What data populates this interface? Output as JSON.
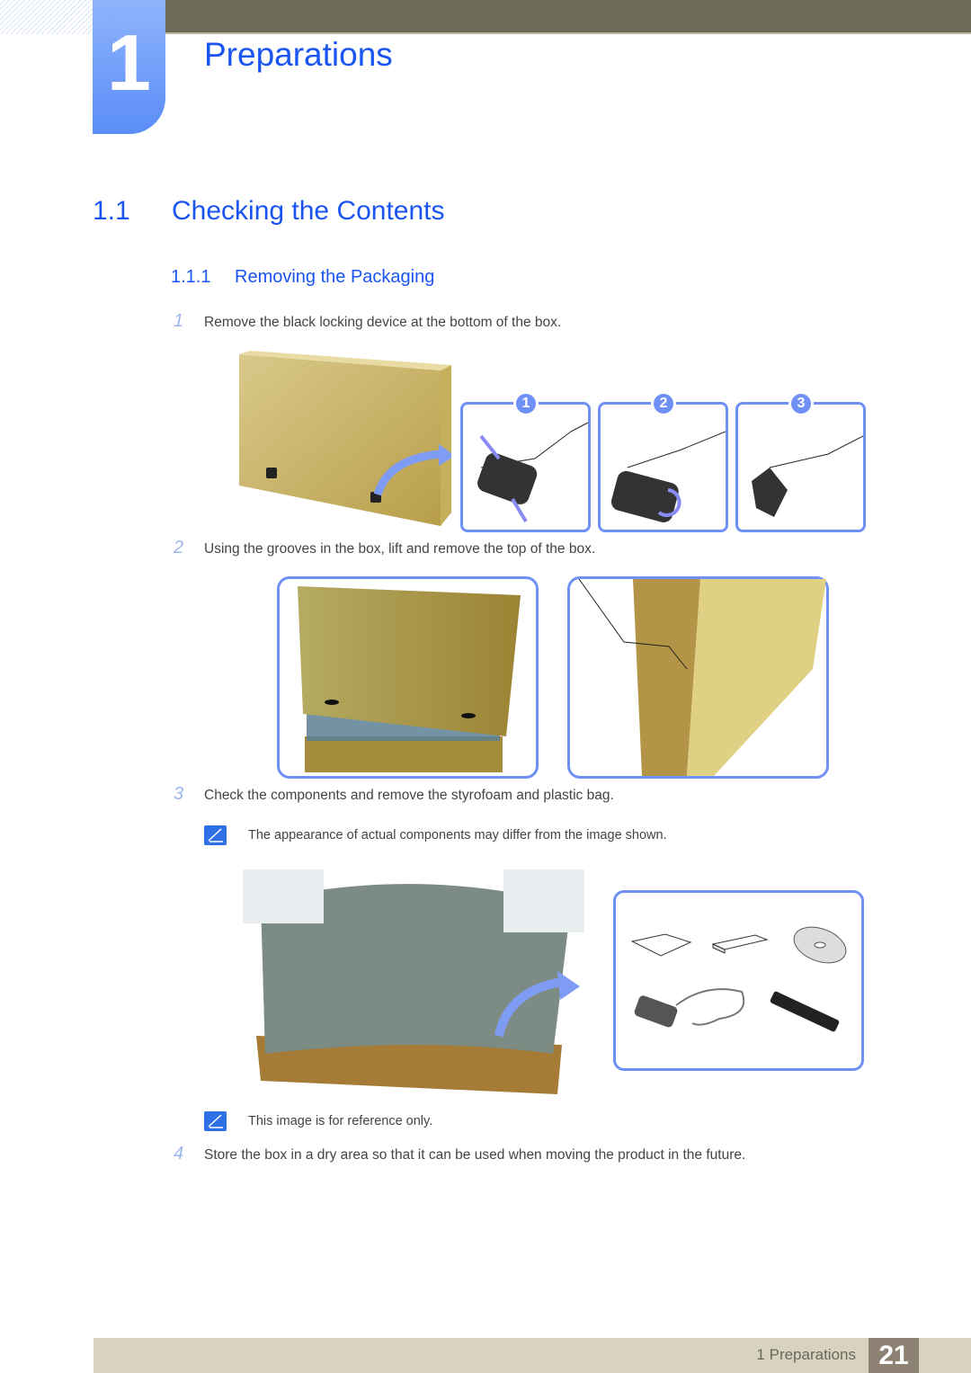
{
  "chapter": {
    "number": "1",
    "title": "Preparations"
  },
  "section": {
    "number": "1.1",
    "title": "Checking the Contents"
  },
  "subsection": {
    "number": "1.1.1",
    "title": "Removing the Packaging"
  },
  "steps": [
    {
      "number": "1",
      "text": "Remove the black locking device at the bottom of the box."
    },
    {
      "number": "2",
      "text": "Using the grooves in the box, lift and remove the top of the box."
    },
    {
      "number": "3",
      "text": "Check the components and remove the styrofoam and plastic bag."
    },
    {
      "number": "4",
      "text": "Store the box in a dry area so that it can be used when moving the product in the future."
    }
  ],
  "notes": [
    {
      "icon": "note-pencil-icon",
      "text": "The appearance of actual components may differ from the image shown."
    },
    {
      "icon": "note-pencil-icon",
      "text": "This image is for reference only."
    }
  ],
  "figures": {
    "step1_badges": [
      "1",
      "2",
      "3"
    ],
    "components": [
      "manual-icon",
      "warranty-card-icon",
      "cd-icon",
      "power-adapter-icon",
      "remote-control-icon"
    ]
  },
  "footer": {
    "label": "1 Preparations",
    "page": "21"
  },
  "colors": {
    "accent": "#1a55f2",
    "frame": "#6f90f6",
    "header_bar": "#6c6b56",
    "footer_bar": "#d8d3bf",
    "page_box": "#8d8174"
  }
}
